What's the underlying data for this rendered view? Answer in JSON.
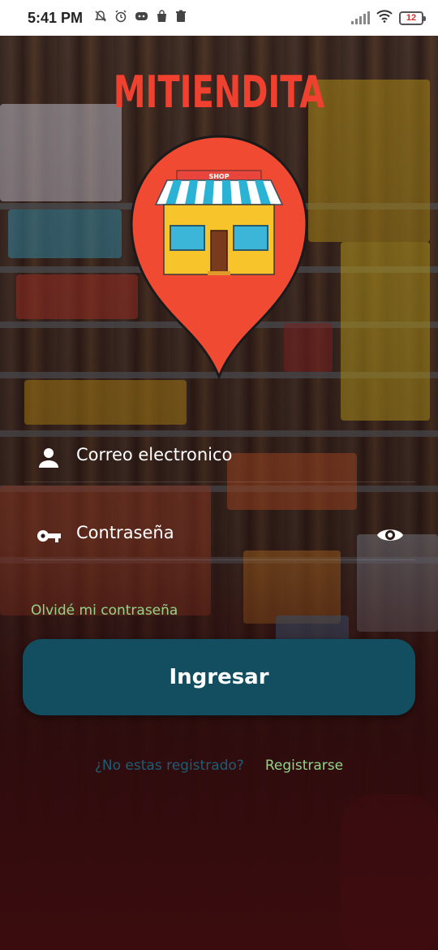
{
  "status_bar": {
    "time": "5:41 PM",
    "battery": "12",
    "icons_left": [
      "mute-notification-icon",
      "alarm-icon",
      "discord-icon",
      "shop-bag-icon",
      "trash-icon"
    ],
    "icons_right": [
      "signal-icon",
      "wifi-icon",
      "battery-icon"
    ]
  },
  "app": {
    "title": "MITIENDITA",
    "logo_sign": "SHOP",
    "title_color": "#ef4030"
  },
  "login_form": {
    "email_placeholder": "Correo electronico",
    "password_placeholder": "Contraseña",
    "forgot_password": "Olvidé mi contraseña",
    "submit_label": "Ingresar"
  },
  "register": {
    "question": "¿No estas registrado?",
    "link": "Registrarse"
  },
  "colors": {
    "primary_button": "#134e60",
    "accent_green": "#93d48a",
    "question_text": "#1f5d73",
    "pin_red": "#ef4030"
  }
}
